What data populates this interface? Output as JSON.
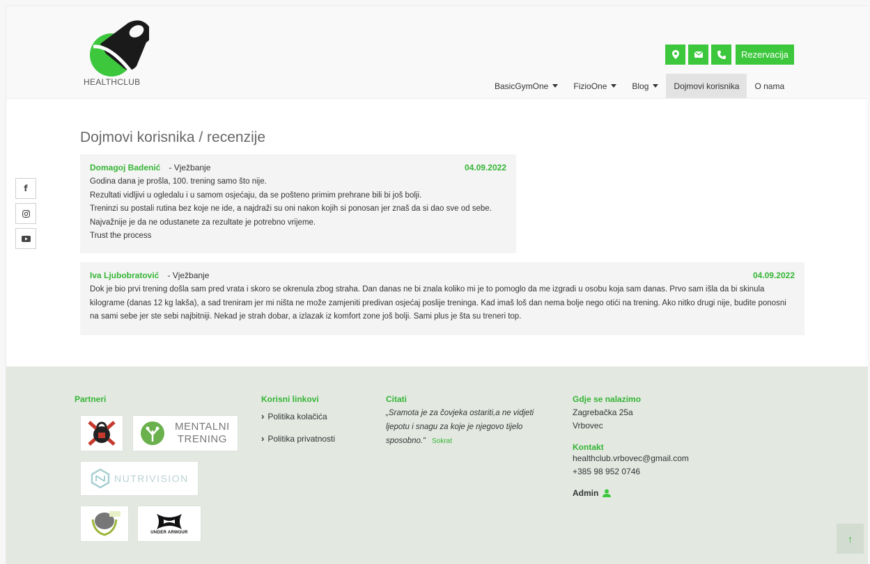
{
  "brand": {
    "logo_text": "HEALTHCLUB"
  },
  "header": {
    "icon_buttons": [
      {
        "icon": "location-pin-icon"
      },
      {
        "icon": "envelope-icon"
      },
      {
        "icon": "phone-icon"
      }
    ],
    "reservation_label": "Rezervacija"
  },
  "nav": {
    "items": [
      {
        "label": "BasicGymOne",
        "dropdown": true
      },
      {
        "label": "FizioOne",
        "dropdown": true
      },
      {
        "label": "Blog",
        "dropdown": true
      },
      {
        "label": "Dojmovi korisnika",
        "active": true
      },
      {
        "label": "O nama"
      }
    ]
  },
  "social": [
    "facebook-icon",
    "instagram-icon",
    "youtube-icon"
  ],
  "page": {
    "title": "Dojmovi korisnika / recenzije"
  },
  "reviews": [
    {
      "name": "Domagoj Badenić",
      "category": "- Vježbanje",
      "date": "04.09.2022",
      "lines": [
        "Godina dana je prošla, 100. trening samo što nije.",
        "Rezultati vidljivi u ogledalu i u samom osjećaju, da se pošteno primim prehrane bili bi još bolji.",
        "Treninzi su postali rutina bez koje ne ide, a najdraži su oni nakon kojih si ponosan jer znaš da si dao sve od sebe.",
        "Najvažnije je da ne odustanete za rezultate je potrebno vrijeme.",
        "Trust the process"
      ]
    },
    {
      "name": "Iva Ljubobratović",
      "category": "- Vježbanje",
      "date": "04.09.2022",
      "text": "Dok je bio prvi trening došla sam pred vrata i skoro se okrenula zbog straha. Dan danas ne bi znala koliko mi je to pomoglo da me izgradi u osobu koja sam danas. Prvo sam išla da bi skinula kilograme (danas 12 kg lakša), a sad treniram jer mi ništa ne može zamjeniti predivan osjećaj poslije treninga. Kad imaš loš dan nema bolje nego otići na trening. Ako nitko drugi nije, budite ponosni na sami sebe jer ste sebi najbitniji. Nekad je strah dobar, a izlazak iz komfort zone još bolji. Sami plus je šta su treneri top."
    }
  ],
  "footer": {
    "partners": {
      "heading": "Partneri",
      "mentalni_line1": "MENTALNI",
      "mentalni_line2": "TRENING",
      "nutrivision": "NUTRIVISION",
      "under_armour": "UNDER ARMOUR"
    },
    "links": {
      "heading": "Korisni linkovi",
      "items": [
        "Politika kolačića",
        "Politika privatnosti"
      ]
    },
    "citati": {
      "heading": "Citati",
      "quote": "„Sramota je za čovjeka ostariti,a ne vidjeti ljepotu i snagu za koje je njegovo tijelo sposobno.“",
      "author": "Sokrat"
    },
    "location": {
      "heading": "Gdje se nalazimo",
      "street": "Zagrebačka 25a",
      "city": "Vrbovec"
    },
    "contact": {
      "heading": "Kontakt",
      "email": "healthclub.vrbovec@gmail.com",
      "phone": "+385 98 952 0746"
    },
    "admin_label": "Admin"
  },
  "colors": {
    "accent": "#3cc73c",
    "footer_bg": "#e3e8e1"
  }
}
